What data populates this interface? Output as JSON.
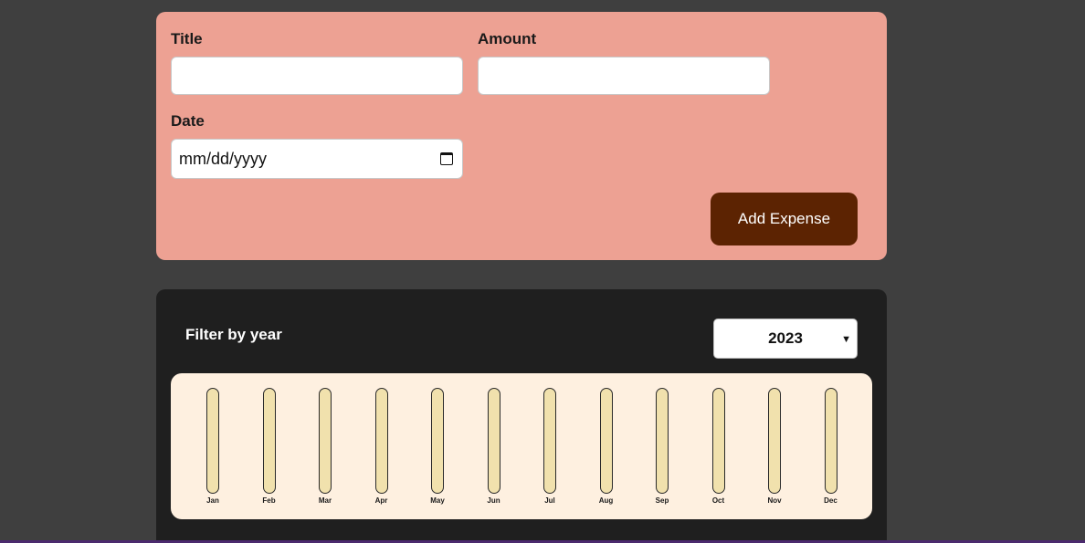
{
  "form": {
    "title_label": "Title",
    "amount_label": "Amount",
    "date_label": "Date",
    "title_value": "",
    "amount_value": "",
    "date_placeholder": "mm/dd/yyyy",
    "submit_label": "Add Expense"
  },
  "filter": {
    "label": "Filter by year",
    "selected_year": "2023"
  },
  "chart_data": {
    "type": "bar",
    "categories": [
      "Jan",
      "Feb",
      "Mar",
      "Apr",
      "May",
      "Jun",
      "Jul",
      "Aug",
      "Sep",
      "Oct",
      "Nov",
      "Dec"
    ],
    "values": [
      0,
      0,
      0,
      0,
      0,
      0,
      0,
      0,
      0,
      0,
      0,
      0
    ]
  },
  "colors": {
    "page_bg": "#3f3f3f",
    "form_bg": "#eda193",
    "button_bg": "#5c2302",
    "panel_bg": "#1f1f1f",
    "chart_bg": "#fef0e0",
    "bar_track": "#f1e1ad"
  }
}
